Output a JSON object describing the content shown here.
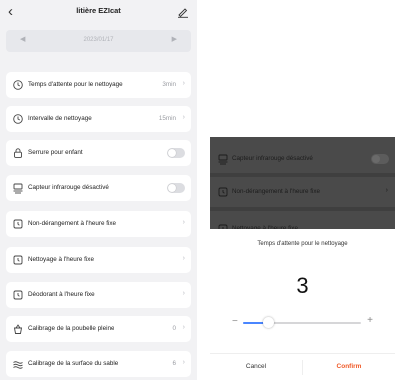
{
  "device_title": "litière EZIcat",
  "date_bar": {
    "date": "2023/01/17"
  },
  "settings": [
    {
      "label": "Temps d'attente pour le nettoyage",
      "value": "3min",
      "control": "chevron",
      "icon": "clock-icon"
    },
    {
      "label": "Intervalle de nettoyage",
      "value": "15min",
      "control": "chevron",
      "icon": "clock-icon"
    },
    {
      "label": "Serrure pour enfant",
      "value": "",
      "control": "toggle",
      "enabled": false,
      "icon": "lock-icon"
    },
    {
      "label": "Capteur infrarouge désactivé",
      "value": "",
      "control": "toggle",
      "enabled": false,
      "icon": "sensor-icon"
    },
    {
      "label": "Non-dérangement à l'heure fixe",
      "value": "",
      "control": "chevron",
      "icon": "alarm-icon"
    },
    {
      "label": "Nettoyage à l'heure fixe",
      "value": "",
      "control": "chevron",
      "icon": "alarm-icon"
    },
    {
      "label": "Déodorant à l'heure fixe",
      "value": "",
      "control": "chevron",
      "icon": "alarm-icon"
    },
    {
      "label": "Calibrage de la poubelle pleine",
      "value": "0",
      "control": "chevron",
      "icon": "bin-icon"
    },
    {
      "label": "Calibrage de la surface du sable",
      "value": "6",
      "control": "chevron",
      "icon": "sand-icon"
    }
  ],
  "background_rows": [
    {
      "label": "Capteur infrarouge désactivé",
      "control": "toggle"
    },
    {
      "label": "Non-dérangement à l'heure fixe",
      "control": "chevron"
    },
    {
      "label": "Nettoyage à l'heure fixe",
      "control": "chevron"
    }
  ],
  "dialog": {
    "title": "Temps d'attente pour le nettoyage",
    "value": "3",
    "slider_fraction": 0.22,
    "minus": "−",
    "plus": "+",
    "cancel_label": "Cancel",
    "confirm_label": "Confirm"
  },
  "colors": {
    "accent": "#f05a28",
    "slider": "#4a86ff",
    "toggle_off": "#dcdde1"
  }
}
